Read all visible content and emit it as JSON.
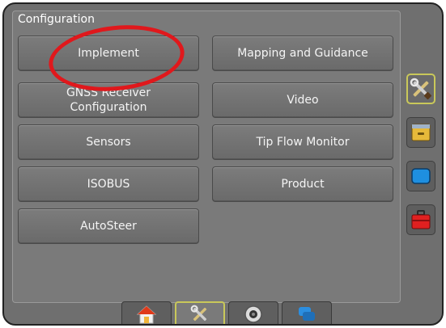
{
  "panel": {
    "title": "Configuration"
  },
  "buttons": {
    "implement": "Implement",
    "mapping_guidance": "Mapping and Guidance",
    "gnss": "GNSS Receiver\nConfiguration",
    "video": "Video",
    "sensors": "Sensors",
    "tip_flow": "Tip Flow Monitor",
    "isobus": "ISOBUS",
    "product": "Product",
    "autosteer": "AutoSteer"
  },
  "sidebar": {
    "icons": [
      "tools-icon",
      "drawer-icon",
      "blue-screen-icon",
      "toolbox-icon"
    ],
    "active": "tools-icon"
  },
  "bottom_tabs": {
    "icons": [
      "home-icon",
      "tools-icon",
      "camera-icon",
      "screens-icon"
    ],
    "active": "tools-icon"
  },
  "colors": {
    "annotation": "#e0181c",
    "active_border": "#c9c85a",
    "panel_bg": "#7a7a7a",
    "screen_bg": "#6f6f6f"
  }
}
